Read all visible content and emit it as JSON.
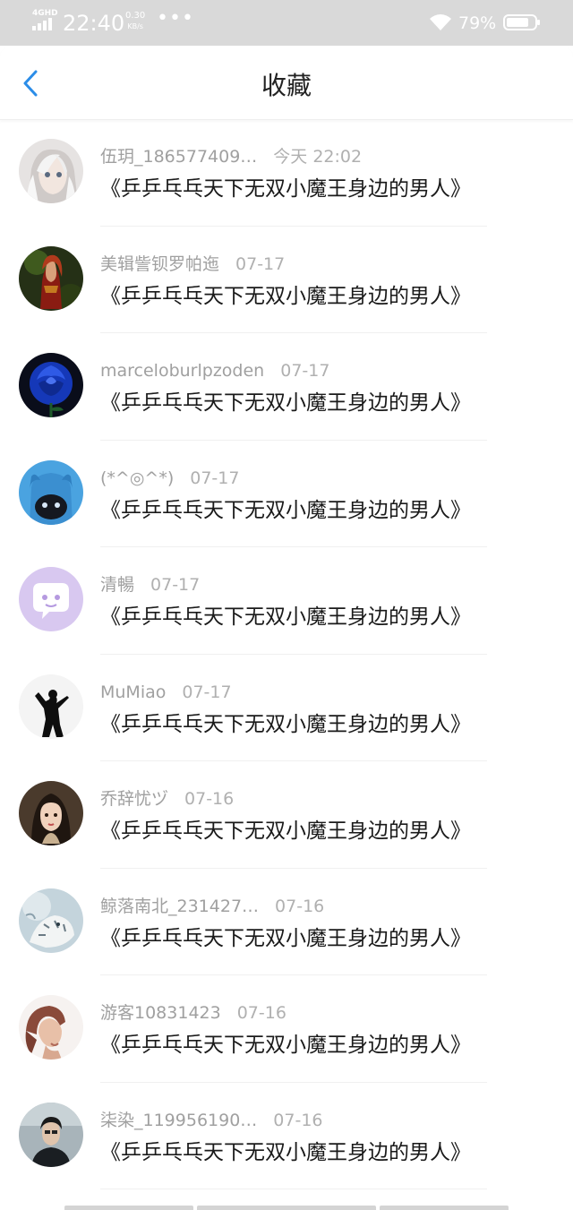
{
  "status_bar": {
    "network": "4GHD",
    "time": "22:40",
    "speed_value": "0.30",
    "speed_unit": "KB/s",
    "more": "•••",
    "battery_percent": "79%",
    "battery_level": 0.79
  },
  "header": {
    "back_icon": "chevron-left-icon",
    "title": "收藏",
    "accent_color": "#2b8de8"
  },
  "favorites": [
    {
      "user": "伍玥_186577409…",
      "time": "今天 22:02",
      "title": "《乒乒乓乓天下无双小魔王身边的男人》",
      "avatar": "anime-character"
    },
    {
      "user": "美辑訾钡罗帕迤",
      "time": "07-17",
      "title": "《乒乒乓乓天下无双小魔王身边的男人》",
      "avatar": "fantasy-warrior"
    },
    {
      "user": "marceloburlpzoden",
      "time": "07-17",
      "title": "《乒乒乓乓天下无双小魔王身边的男人》",
      "avatar": "blue-rose"
    },
    {
      "user": "(*^◎^*)",
      "time": "07-17",
      "title": "《乒乒乓乓天下无双小魔王身边的男人》",
      "avatar": "blue-cat"
    },
    {
      "user": "清暢",
      "time": "07-17",
      "title": "《乒乒乓乓天下无双小魔王身边的男人》",
      "avatar": "chat-bubble-default"
    },
    {
      "user": "MuMiao",
      "time": "07-17",
      "title": "《乒乒乓乓天下无双小魔王身边的男人》",
      "avatar": "silhouette"
    },
    {
      "user": "乔辞忧ヅ",
      "time": "07-16",
      "title": "《乒乒乓乓天下无双小魔王身边的男人》",
      "avatar": "woman-portrait"
    },
    {
      "user": "鲸落南北_231427…",
      "time": "07-16",
      "title": "《乒乒乓乓天下无双小魔王身边的男人》",
      "avatar": "white-tiger"
    },
    {
      "user": "游客10831423",
      "time": "07-16",
      "title": "《乒乒乓乓天下无双小魔王身边的男人》",
      "avatar": "woman-profile"
    },
    {
      "user": "柒染_119956190…",
      "time": "07-16",
      "title": "《乒乒乓乓天下无双小魔王身边的男人》",
      "avatar": "man-portrait"
    }
  ]
}
